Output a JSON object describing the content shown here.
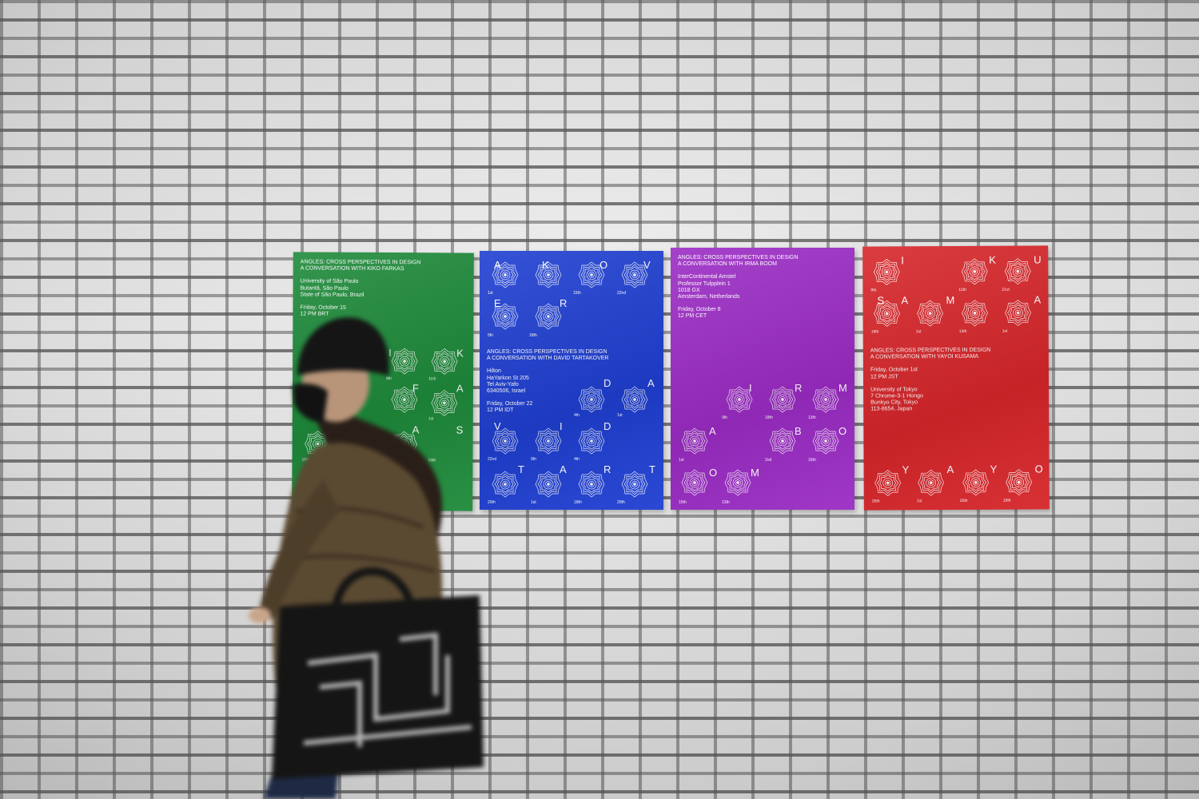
{
  "posters": [
    {
      "id": "green",
      "color": "#1e8a3a",
      "lines": [
        "ANGLES: CROSS PERSPECTIVES IN DESIGN",
        "A CONVERSATION WITH KIKO FARKAS",
        "",
        "University of São Paulo",
        "Butantã, São Paulo",
        "State of São Paulo, Brazil",
        "",
        "Friday, October 15",
        "12 PM BRT"
      ],
      "letters": [
        "I",
        "K",
        "F",
        "A",
        "A",
        "S"
      ],
      "dates": [
        "9th",
        "11th",
        "1st",
        "18th",
        "15th"
      ]
    },
    {
      "id": "blue",
      "color": "#1f3fd1",
      "lines": [
        "ANGLES: CROSS PERSPECTIVES IN DESIGN",
        "A CONVERSATION WITH DAVID TARTAKOVER",
        "",
        "Hilton",
        "HaYarkon St 205",
        "Tel Aviv-Yafo",
        "6340506, Israel",
        "",
        "Friday, October 22",
        "12 PM IDT"
      ],
      "letters": [
        "A",
        "K",
        "O",
        "V",
        "E",
        "R",
        "D",
        "A",
        "V",
        "I",
        "D",
        "T",
        "A",
        "R",
        "T"
      ],
      "dates": [
        "1st",
        "15th",
        "22nd",
        "5th",
        "18th",
        "4th",
        "1st",
        "22nd",
        "9th",
        "4th",
        "20th",
        "1st",
        "18th",
        "20th"
      ]
    },
    {
      "id": "purple",
      "color": "#9b2cc4",
      "lines": [
        "ANGLES: CROSS PERSPECTIVES IN DESIGN",
        "A CONVERSATION WITH IRMA BOOM",
        "",
        "InterContinental Amstel",
        "Professor Tulpplein 1",
        "1018 GX",
        "Amsterdam, Netherlands",
        "",
        "Friday, October 8",
        "12 PM CET"
      ],
      "letters": [
        "I",
        "R",
        "M",
        "A",
        "B",
        "O",
        "O",
        "M"
      ],
      "dates": [
        "9th",
        "18th",
        "13th",
        "1st",
        "2nd",
        "15th",
        "15th",
        "13th"
      ]
    },
    {
      "id": "red",
      "color": "#d6262a",
      "lines": [
        "ANGLES: CROSS PERSPECTIVES IN DESIGN",
        "A CONVERSATION WITH YAYOI KUSAMA",
        "",
        "Friday, October 1st",
        "12 PM JST",
        "",
        "University of Tokyo",
        "7 Chrome-3-1 Hongo",
        "Bunkyo City, Tokyo",
        "113-8654, Japan"
      ],
      "letters": [
        "I",
        "K",
        "U",
        "S",
        "A",
        "M",
        "A",
        "Y",
        "A",
        "Y",
        "O"
      ],
      "dates": [
        "9th",
        "11th",
        "21st",
        "19th",
        "1st",
        "13th",
        "1st",
        "25th",
        "1st",
        "25th",
        "15th"
      ]
    }
  ],
  "colors": {
    "wall": "#e4e4e4",
    "mortar": "#5a5a5a",
    "coat": "#5b4a32",
    "bag": "#151515"
  }
}
